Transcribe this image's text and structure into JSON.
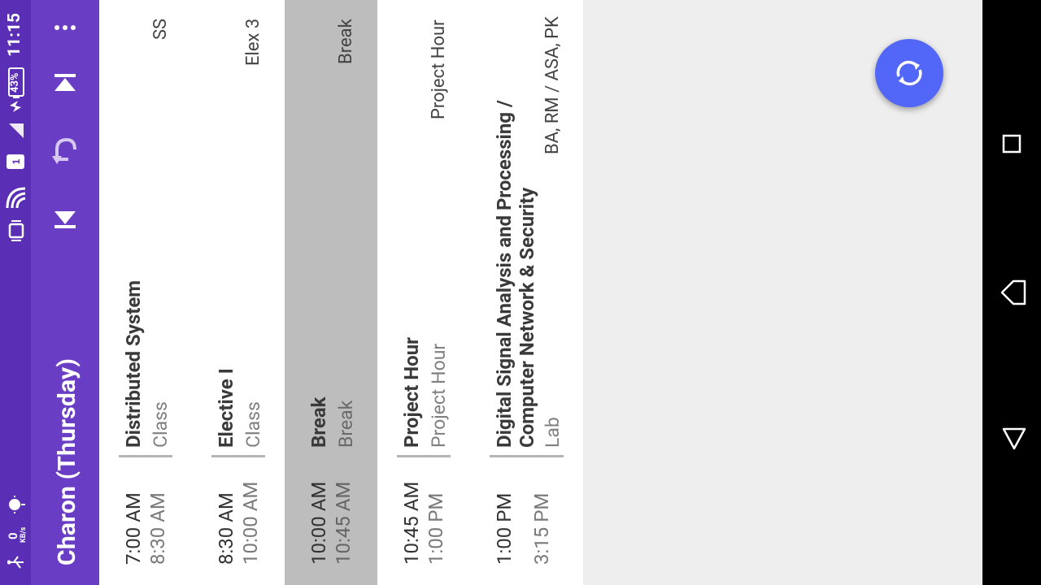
{
  "status_bar": {
    "time": "11:15",
    "battery_pct": "43%",
    "sim_slot": "1",
    "net_speed_value": "0",
    "net_speed_unit": "KB/s"
  },
  "toolbar": {
    "title": "Charon (Thursday)"
  },
  "timetable": [
    {
      "start": "7:00 AM",
      "end": "8:30 AM",
      "name": "Distributed System",
      "type": "Class",
      "detail": "SS",
      "is_break": false
    },
    {
      "start": "8:30 AM",
      "end": "10:00 AM",
      "name": "Elective I",
      "type": "Class",
      "detail": "Elex 3",
      "is_break": false
    },
    {
      "start": "10:00 AM",
      "end": "10:45 AM",
      "name": "Break",
      "type": "Break",
      "detail": "Break",
      "is_break": true
    },
    {
      "start": "10:45 AM",
      "end": "1:00 PM",
      "name": "Project Hour",
      "type": "Project Hour",
      "detail": "Project Hour",
      "is_break": false
    },
    {
      "start": "1:00 PM",
      "end": "3:15 PM",
      "name_line1": "Digital Signal Analysis and Processing /",
      "name_line2": "Computer Network & Security",
      "type": "Lab",
      "detail": "BA, RM / ASA, PK",
      "is_break": false
    }
  ],
  "colors": {
    "status_bar": "#5a2fb5",
    "toolbar": "#6a3ec4",
    "break_row": "#bdbdbd",
    "fab": "#5266f8",
    "background": "#eeeeee"
  },
  "icons": [
    "usb-icon",
    "android-debug-icon",
    "vibrate-icon",
    "wifi-icon",
    "sim-icon",
    "signal-icon",
    "charging-icon",
    "battery-icon",
    "more-vert-icon",
    "first-page-icon",
    "undo-icon",
    "last-page-icon",
    "sync-icon",
    "recents-icon",
    "back-icon",
    "home-icon"
  ]
}
